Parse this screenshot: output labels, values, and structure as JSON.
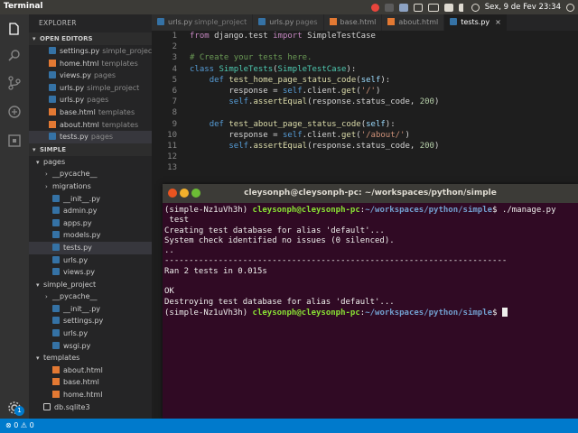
{
  "topbar": {
    "title": "Terminal",
    "clock": "Sex,  9 de Fev 23:34",
    "tray_icons": [
      "chrome-icon",
      "app-icon",
      "dropbox-icon",
      "network-icon",
      "keyboard-icon",
      "pt-icon",
      "volume-icon",
      "clock-icon",
      "power-icon"
    ]
  },
  "activity": {
    "items": [
      "explorer-icon",
      "search-icon",
      "source-control-icon",
      "debug-icon",
      "extensions-icon"
    ],
    "settings_badge": "1"
  },
  "sidebar": {
    "title": "EXPLORER",
    "open_editors_label": "OPEN EDITORS",
    "open_editors": [
      {
        "name": "settings.py",
        "folder": "simple_project"
      },
      {
        "name": "home.html",
        "folder": "templates"
      },
      {
        "name": "views.py",
        "folder": "pages"
      },
      {
        "name": "urls.py",
        "folder": "simple_project"
      },
      {
        "name": "urls.py",
        "folder": "pages"
      },
      {
        "name": "base.html",
        "folder": "templates"
      },
      {
        "name": "about.html",
        "folder": "templates"
      },
      {
        "name": "tests.py",
        "folder": "pages"
      }
    ],
    "project_label": "SIMPLE",
    "tree": [
      {
        "name": "pages",
        "indent": 1,
        "kind": "folder-open"
      },
      {
        "name": "__pycache__",
        "indent": 2,
        "kind": "folder"
      },
      {
        "name": "migrations",
        "indent": 2,
        "kind": "folder"
      },
      {
        "name": "__init__.py",
        "indent": 2,
        "kind": "py"
      },
      {
        "name": "admin.py",
        "indent": 2,
        "kind": "py"
      },
      {
        "name": "apps.py",
        "indent": 2,
        "kind": "py"
      },
      {
        "name": "models.py",
        "indent": 2,
        "kind": "py"
      },
      {
        "name": "tests.py",
        "indent": 2,
        "kind": "py",
        "active": true
      },
      {
        "name": "urls.py",
        "indent": 2,
        "kind": "py"
      },
      {
        "name": "views.py",
        "indent": 2,
        "kind": "py"
      },
      {
        "name": "simple_project",
        "indent": 1,
        "kind": "folder-open"
      },
      {
        "name": "__pycache__",
        "indent": 2,
        "kind": "folder"
      },
      {
        "name": "__init__.py",
        "indent": 2,
        "kind": "py"
      },
      {
        "name": "settings.py",
        "indent": 2,
        "kind": "py"
      },
      {
        "name": "urls.py",
        "indent": 2,
        "kind": "py"
      },
      {
        "name": "wsgi.py",
        "indent": 2,
        "kind": "py"
      },
      {
        "name": "templates",
        "indent": 1,
        "kind": "folder-open"
      },
      {
        "name": "about.html",
        "indent": 2,
        "kind": "html"
      },
      {
        "name": "base.html",
        "indent": 2,
        "kind": "html"
      },
      {
        "name": "home.html",
        "indent": 2,
        "kind": "html"
      },
      {
        "name": "db.sqlite3",
        "indent": 1,
        "kind": "db"
      }
    ]
  },
  "tabs": [
    {
      "name": "urls.py",
      "folder": "simple_project",
      "kind": "py"
    },
    {
      "name": "urls.py",
      "folder": "pages",
      "kind": "py"
    },
    {
      "name": "base.html",
      "folder": "",
      "kind": "html"
    },
    {
      "name": "about.html",
      "folder": "",
      "kind": "html"
    },
    {
      "name": "tests.py",
      "folder": "",
      "kind": "py",
      "active": true,
      "close": "×"
    }
  ],
  "editor": {
    "lines": [
      [
        {
          "t": "from ",
          "c": "kw2"
        },
        {
          "t": "django.test ",
          "c": "plain"
        },
        {
          "t": "import ",
          "c": "kw2"
        },
        {
          "t": "SimpleTestCase",
          "c": "plain"
        }
      ],
      [],
      [
        {
          "t": "# Create your tests here.",
          "c": "cm"
        }
      ],
      [
        {
          "t": "class ",
          "c": "kw"
        },
        {
          "t": "SimpleTests",
          "c": "cls"
        },
        {
          "t": "(",
          "c": "plain"
        },
        {
          "t": "SimpleTestCase",
          "c": "cls"
        },
        {
          "t": "):",
          "c": "plain"
        }
      ],
      [
        {
          "t": "    ",
          "c": "plain"
        },
        {
          "t": "def ",
          "c": "kw"
        },
        {
          "t": "test_home_page_status_code",
          "c": "fn"
        },
        {
          "t": "(",
          "c": "plain"
        },
        {
          "t": "self",
          "c": "self"
        },
        {
          "t": "):",
          "c": "plain"
        }
      ],
      [
        {
          "t": "        response = ",
          "c": "plain"
        },
        {
          "t": "self",
          "c": "kw"
        },
        {
          "t": ".client.",
          "c": "plain"
        },
        {
          "t": "get",
          "c": "fn"
        },
        {
          "t": "(",
          "c": "plain"
        },
        {
          "t": "'/'",
          "c": "str"
        },
        {
          "t": ")",
          "c": "plain"
        }
      ],
      [
        {
          "t": "        ",
          "c": "plain"
        },
        {
          "t": "self",
          "c": "kw"
        },
        {
          "t": ".",
          "c": "plain"
        },
        {
          "t": "assertEqual",
          "c": "fn"
        },
        {
          "t": "(response.status_code, ",
          "c": "plain"
        },
        {
          "t": "200",
          "c": "num"
        },
        {
          "t": ")",
          "c": "plain"
        }
      ],
      [],
      [
        {
          "t": "    ",
          "c": "plain"
        },
        {
          "t": "def ",
          "c": "kw"
        },
        {
          "t": "test_about_page_status_code",
          "c": "fn"
        },
        {
          "t": "(",
          "c": "plain"
        },
        {
          "t": "self",
          "c": "self"
        },
        {
          "t": "):",
          "c": "plain"
        }
      ],
      [
        {
          "t": "        response = ",
          "c": "plain"
        },
        {
          "t": "self",
          "c": "kw"
        },
        {
          "t": ".client.",
          "c": "plain"
        },
        {
          "t": "get",
          "c": "fn"
        },
        {
          "t": "(",
          "c": "plain"
        },
        {
          "t": "'/about/'",
          "c": "str"
        },
        {
          "t": ")",
          "c": "plain"
        }
      ],
      [
        {
          "t": "        ",
          "c": "plain"
        },
        {
          "t": "self",
          "c": "kw"
        },
        {
          "t": ".",
          "c": "plain"
        },
        {
          "t": "assertEqual",
          "c": "fn"
        },
        {
          "t": "(response.status_code, ",
          "c": "plain"
        },
        {
          "t": "200",
          "c": "num"
        },
        {
          "t": ")",
          "c": "plain"
        }
      ],
      [],
      []
    ]
  },
  "terminal": {
    "title": "cleysonph@cleysonph-pc: ~/workspaces/python/simple",
    "lines": [
      [
        {
          "t": "(simple-Nz1uVh3h) ",
          "c": ""
        },
        {
          "t": "cleysonph@cleysonph-pc",
          "c": "t-user"
        },
        {
          "t": ":",
          "c": ""
        },
        {
          "t": "~/workspaces/python/simple",
          "c": "t-path"
        },
        {
          "t": "$ ./manage.py",
          "c": ""
        }
      ],
      [
        {
          "t": " test",
          "c": ""
        }
      ],
      [
        {
          "t": "Creating test database for alias 'default'...",
          "c": ""
        }
      ],
      [
        {
          "t": "System check identified no issues (0 silenced).",
          "c": ""
        }
      ],
      [
        {
          "t": "..",
          "c": ""
        }
      ],
      [
        {
          "t": "----------------------------------------------------------------------",
          "c": ""
        }
      ],
      [
        {
          "t": "Ran 2 tests in 0.015s",
          "c": ""
        }
      ],
      [],
      [
        {
          "t": "OK",
          "c": ""
        }
      ],
      [
        {
          "t": "Destroying test database for alias 'default'...",
          "c": ""
        }
      ],
      [
        {
          "t": "(simple-Nz1uVh3h) ",
          "c": ""
        },
        {
          "t": "cleysonph@cleysonph-pc",
          "c": "t-user"
        },
        {
          "t": ":",
          "c": ""
        },
        {
          "t": "~/workspaces/python/simple",
          "c": "t-path"
        },
        {
          "t": "$ ",
          "c": ""
        }
      ]
    ]
  },
  "statusbar": {
    "errors": "0",
    "warnings": "0"
  },
  "colors": {
    "py": "#3572a5",
    "html": "#e37933",
    "folder": "#c09553",
    "db": "#cccccc",
    "accent": "#007acc",
    "terminal_bg": "#300a24"
  }
}
